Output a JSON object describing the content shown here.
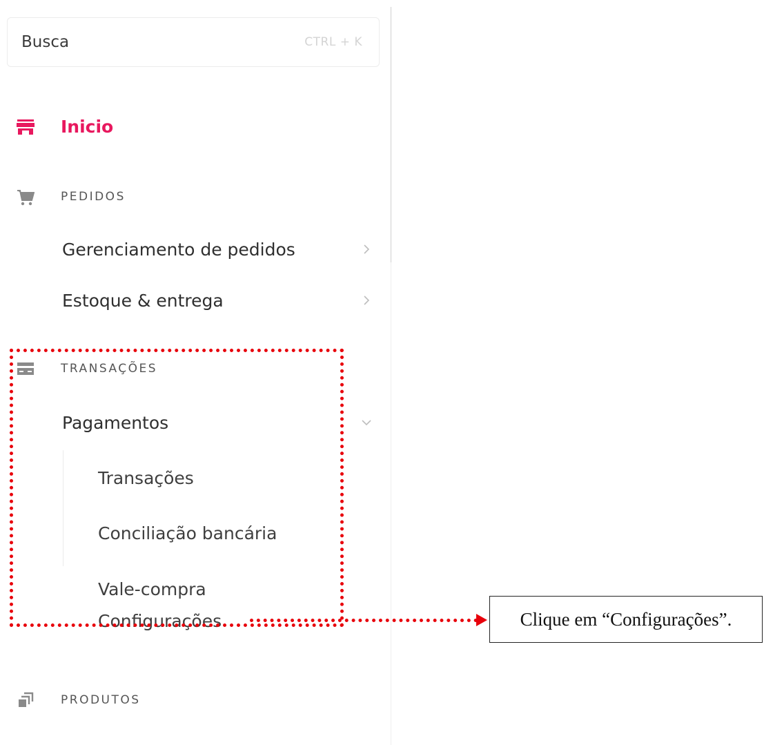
{
  "search": {
    "label": "Busca",
    "shortcut": "CTRL + K"
  },
  "nav": {
    "home": {
      "label": "Inicio",
      "icon": "store-icon",
      "color": "#e8185e"
    },
    "sections": {
      "pedidos": {
        "label": "PEDIDOS",
        "icon": "cart-icon",
        "items": [
          "Gerenciamento de pedidos",
          "Estoque & entrega"
        ]
      },
      "transacoes": {
        "label": "TRANSAÇÕES",
        "icon": "card-icon",
        "items": [
          {
            "label": "Pagamentos",
            "expanded": true,
            "subitems": [
              "Transações",
              "Conciliação bancária",
              "Vale-compra",
              "Configurações"
            ]
          }
        ]
      },
      "produtos": {
        "label": "PRODUTOS",
        "icon": "products-icon"
      }
    }
  },
  "annotation": {
    "callout_text": "Clique em “Configurações”.",
    "highlight_color": "#e8000b"
  }
}
